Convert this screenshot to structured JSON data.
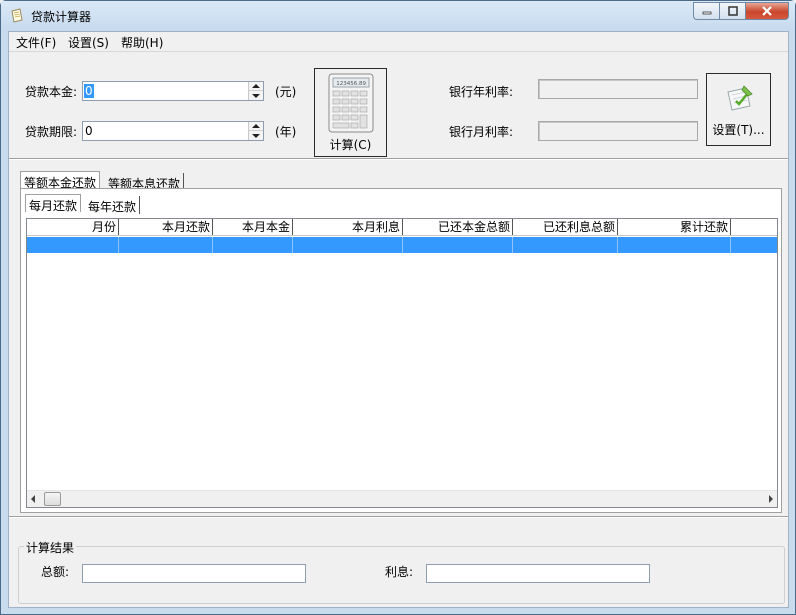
{
  "window": {
    "title": "贷款计算器",
    "colors": {
      "accent": "#3399ff",
      "close": "#c9462c",
      "frame": "#c9dced"
    }
  },
  "menu": {
    "items": [
      "文件(F)",
      "设置(S)",
      "帮助(H)"
    ]
  },
  "inputs": {
    "principal": {
      "label": "贷款本金:",
      "value": "0",
      "unit": "(元)"
    },
    "term": {
      "label": "贷款期限:",
      "value": "0",
      "unit": "(年)"
    }
  },
  "calc_button": {
    "label": "计算(C)",
    "icon": "calculator-icon"
  },
  "rates": {
    "annual": {
      "label": "银行年利率:",
      "value": ""
    },
    "monthly": {
      "label": "银行月利率:",
      "value": ""
    }
  },
  "settings_button": {
    "label": "设置(T)...",
    "icon": "pencil-note-icon"
  },
  "outer_tabs": [
    "等额本金还款",
    "等额本息还款"
  ],
  "inner_tabs": [
    "每月还款",
    "每年还款"
  ],
  "table": {
    "columns": [
      "月份",
      "本月还款",
      "本月本金",
      "本月利息",
      "已还本金总额",
      "已还利息总额",
      "累计还款"
    ]
  },
  "results": {
    "title": "计算结果",
    "total": {
      "label": "总额:",
      "value": ""
    },
    "interest": {
      "label": "利息:",
      "value": ""
    }
  }
}
